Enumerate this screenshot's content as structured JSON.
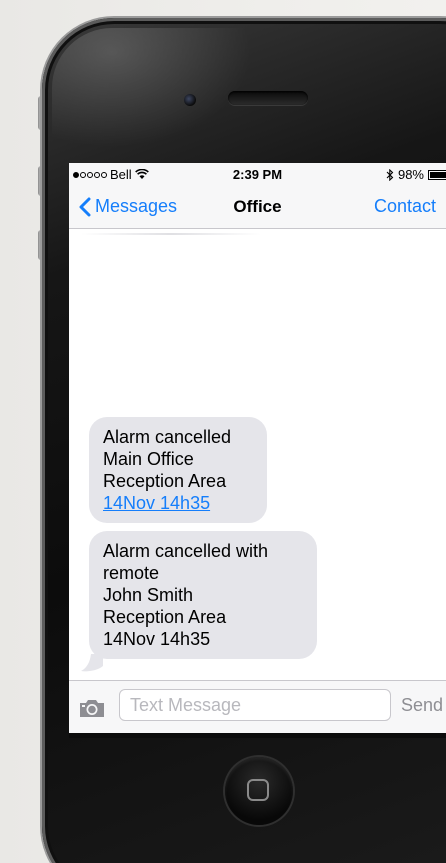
{
  "status_bar": {
    "carrier": "Bell",
    "signal_bars": 1,
    "signal_total": 5,
    "wifi_icon": "wifi-icon",
    "time": "2:39 PM",
    "bluetooth_icon": "bluetooth-icon",
    "battery_percent_label": "98%",
    "battery_level": 0.98
  },
  "nav": {
    "back_label": "Messages",
    "title": "Office",
    "contact_label": "Contact"
  },
  "messages": [
    {
      "lines": [
        "Alarm cancelled",
        "Main Office",
        "Reception Area"
      ],
      "link": "14Nov 14h35"
    },
    {
      "lines": [
        "Alarm cancelled with",
        "remote",
        "John Smith",
        "Reception Area",
        "14Nov 14h35"
      ]
    }
  ],
  "composer": {
    "placeholder": "Text Message",
    "value": "",
    "send_label": "Send",
    "camera_icon": "camera-icon"
  },
  "colors": {
    "accent": "#157efb",
    "bubble_received": "#e5e5ea",
    "bar_background": "#f7f7f8",
    "send_disabled": "#8e8e93"
  }
}
